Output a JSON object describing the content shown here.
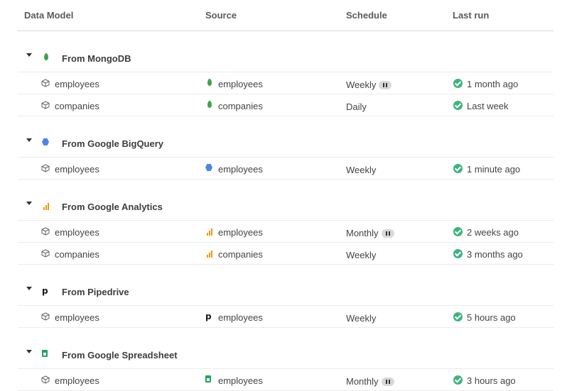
{
  "header": {
    "col_model": "Data Model",
    "col_source": "Source",
    "col_schedule": "Schedule",
    "col_lastrun": "Last run"
  },
  "groups": [
    {
      "title": "From MongoDB",
      "icon": "mongodb-icon",
      "rows": [
        {
          "model": "employees",
          "source": "employees",
          "schedule": "Weekly",
          "paused": true,
          "last_run": "1 month ago"
        },
        {
          "model": "companies",
          "source": "companies",
          "schedule": "Daily",
          "paused": false,
          "last_run": "Last week"
        }
      ]
    },
    {
      "title": "From Google BigQuery",
      "icon": "bigquery-icon",
      "rows": [
        {
          "model": "employees",
          "source": "employees",
          "schedule": "Weekly",
          "paused": false,
          "last_run": "1 minute ago"
        }
      ]
    },
    {
      "title": "From Google Analytics",
      "icon": "google-analytics-icon",
      "rows": [
        {
          "model": "employees",
          "source": "employees",
          "schedule": "Monthly",
          "paused": true,
          "last_run": "2 weeks ago"
        },
        {
          "model": "companies",
          "source": "companies",
          "schedule": "Weekly",
          "paused": false,
          "last_run": "3 months ago"
        }
      ]
    },
    {
      "title": "From Pipedrive",
      "icon": "pipedrive-icon",
      "rows": [
        {
          "model": "employees",
          "source": "employees",
          "schedule": "Weekly",
          "paused": false,
          "last_run": "5 hours ago"
        }
      ]
    },
    {
      "title": "From Google Spreadsheet",
      "icon": "google-sheets-icon",
      "rows": [
        {
          "model": "employees",
          "source": "employees",
          "schedule": "Monthly",
          "paused": true,
          "last_run": "3 hours ago"
        }
      ]
    }
  ],
  "colors": {
    "success": "#3fb37f",
    "mongodb": "#3fa34d",
    "bigquery": "#4a86e8",
    "analytics": "#f29900",
    "sheets": "#1fa463"
  }
}
